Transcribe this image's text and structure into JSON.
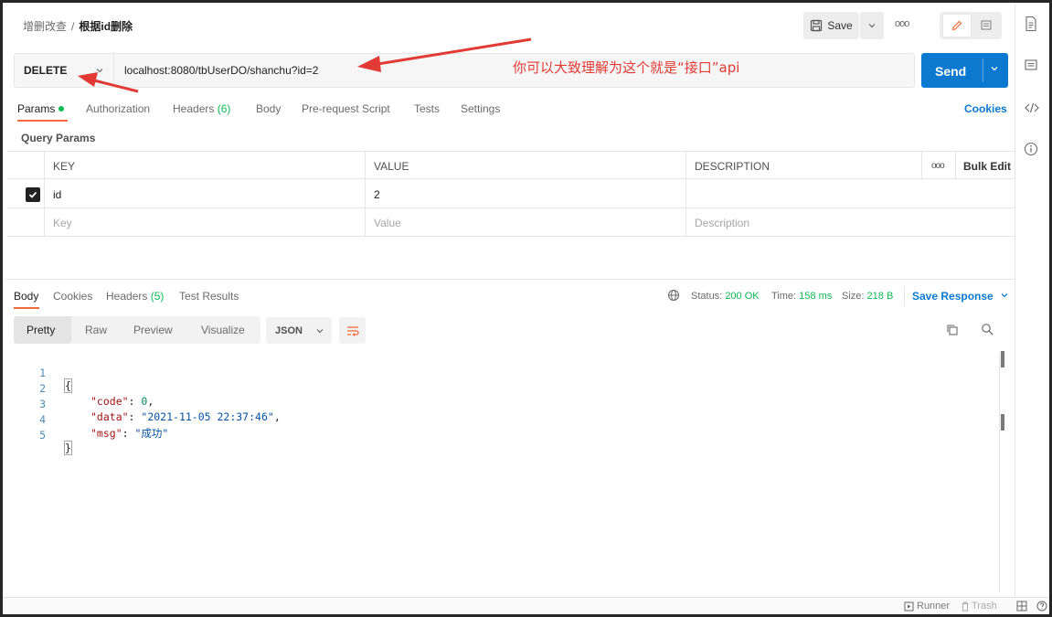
{
  "header": {
    "breadcrumb_parent": "增删改查",
    "breadcrumb_sep": "/",
    "breadcrumb_current": "根据id删除",
    "save_label": "Save",
    "more_label": "ooo"
  },
  "request": {
    "method": "DELETE",
    "url": "localhost:8080/tbUserDO/shanchu?id=2",
    "send_label": "Send",
    "annotation": "你可以大致理解为这个就是“接口”api"
  },
  "request_tabs": {
    "params": "Params",
    "authorization": "Authorization",
    "headers": "Headers",
    "headers_count": "(6)",
    "body": "Body",
    "prerequest": "Pre-request Script",
    "tests": "Tests",
    "settings": "Settings",
    "cookies": "Cookies"
  },
  "query_params": {
    "title": "Query Params",
    "col_key": "KEY",
    "col_value": "VALUE",
    "col_description": "DESCRIPTION",
    "more": "ooo",
    "bulk_edit": "Bulk Edit",
    "rows": [
      {
        "key": "id",
        "value": "2",
        "description": "",
        "checked": true
      }
    ],
    "placeholder_key": "Key",
    "placeholder_value": "Value",
    "placeholder_description": "Description"
  },
  "response_tabs": {
    "body": "Body",
    "cookies": "Cookies",
    "headers": "Headers",
    "headers_count": "(5)",
    "test_results": "Test Results"
  },
  "response_status": {
    "status_label": "Status:",
    "status_value": "200 OK",
    "time_label": "Time:",
    "time_value": "158 ms",
    "size_label": "Size:",
    "size_value": "218 B",
    "save_response": "Save Response"
  },
  "response_format": {
    "pretty": "Pretty",
    "raw": "Raw",
    "preview": "Preview",
    "visualize": "Visualize",
    "json": "JSON"
  },
  "response_body": {
    "lines": [
      {
        "n": "1",
        "open": "{"
      },
      {
        "n": "2",
        "key": "\"code\"",
        "colon": ": ",
        "value": "0",
        "comma": ","
      },
      {
        "n": "3",
        "key": "\"data\"",
        "colon": ": ",
        "value": "\"2021-11-05 22:37:46\"",
        "comma": ","
      },
      {
        "n": "4",
        "key": "\"msg\"",
        "colon": ": ",
        "value": "\"成功\"",
        "comma": ""
      },
      {
        "n": "5",
        "close": "}"
      }
    ]
  },
  "footer": {
    "runner": "Runner",
    "trash": "Trash"
  },
  "colors": {
    "accent": "#0b79d0",
    "orange": "#f26b3a",
    "green": "#0cbb52",
    "annotation_red": "#e23a34"
  }
}
